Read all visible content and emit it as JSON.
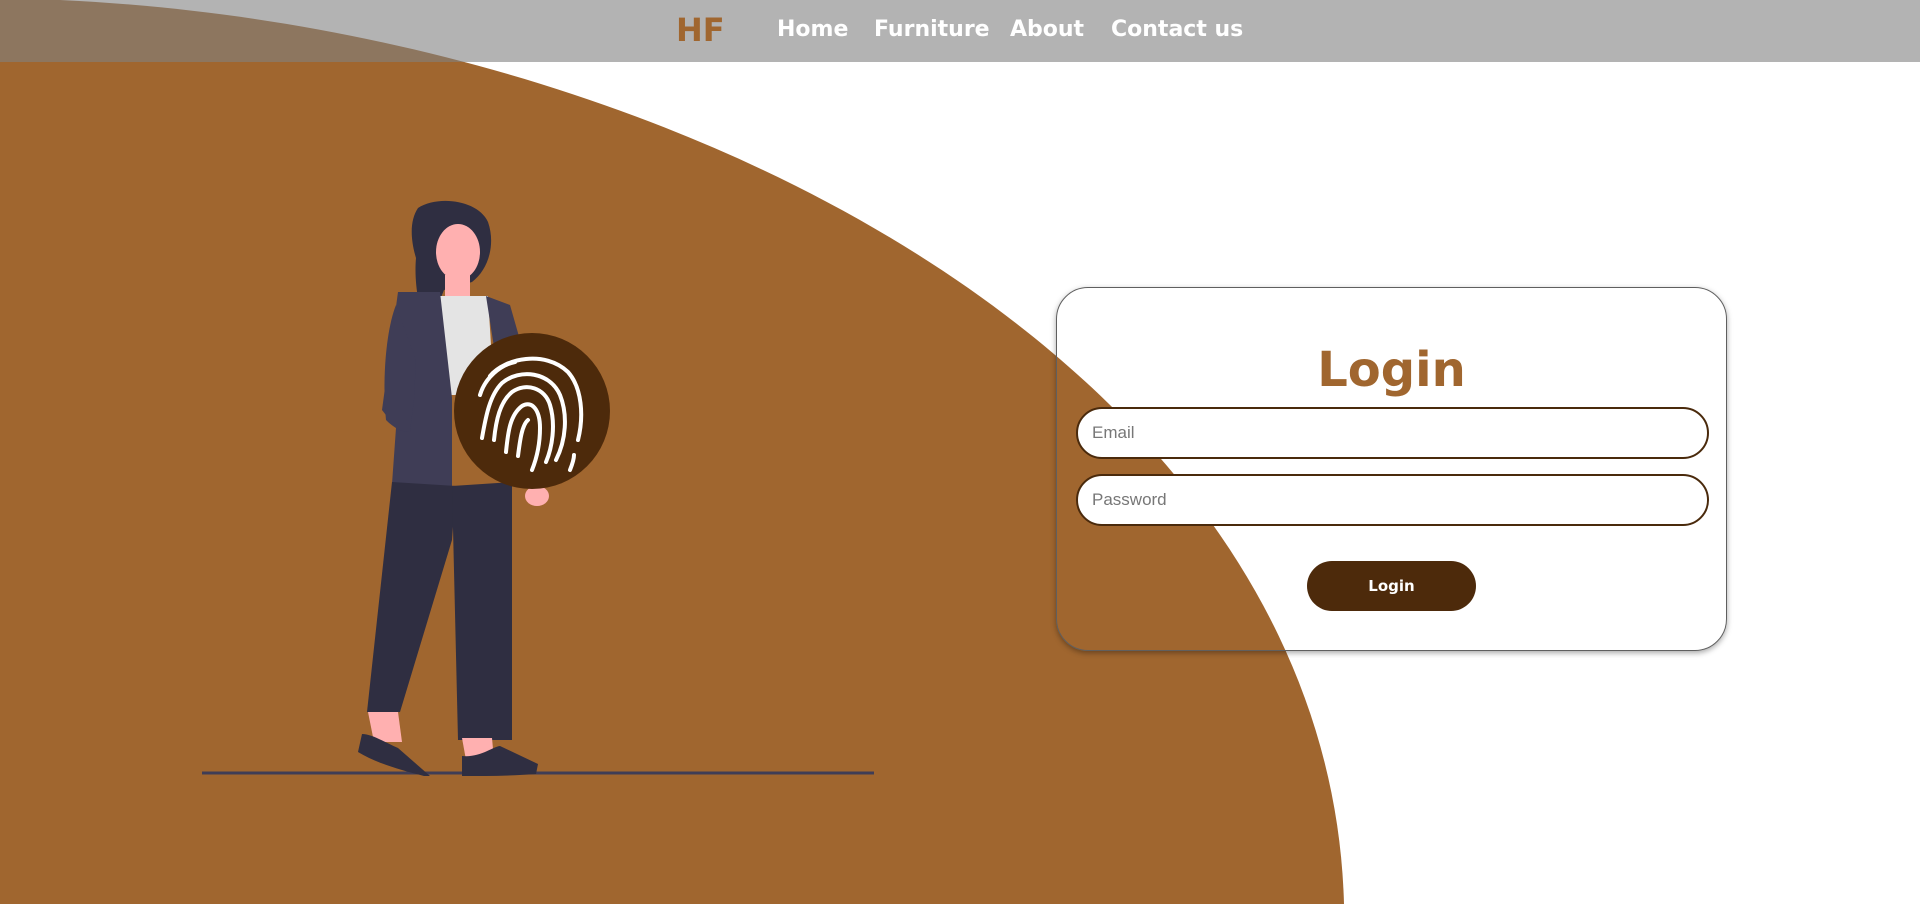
{
  "colors": {
    "brand_brown": "#a0662f",
    "dark_brown": "#4d2a0b",
    "navbar_overlay": "rgba(128,128,128,0.6)",
    "background": "#ffffff"
  },
  "navbar": {
    "logo": "HF",
    "links": [
      {
        "label": "Home"
      },
      {
        "label": "Furniture"
      },
      {
        "label": "About"
      },
      {
        "label": "Contact us"
      }
    ]
  },
  "illustration": {
    "icon": "fingerprint-icon"
  },
  "login": {
    "title": "Login",
    "email": {
      "placeholder": "Email",
      "value": ""
    },
    "password": {
      "placeholder": "Password",
      "value": ""
    },
    "button_label": "Login"
  }
}
